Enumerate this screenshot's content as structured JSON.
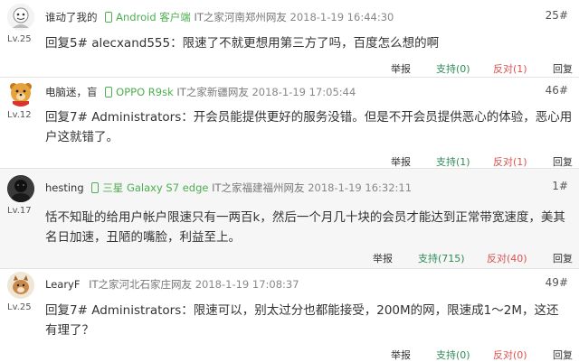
{
  "comments": [
    {
      "username": "谁动了我的",
      "device": "Android 客户端",
      "location": "IT之家河南郑州网友",
      "time": "2018-1-19 16:44:30",
      "floor": "25#",
      "level": "Lv.25",
      "content": "回复5# alecxand555：限速了不就更想用第三方了吗，百度怎么想的啊",
      "report": "举报",
      "support": "支持(0)",
      "oppose": "反对(1)",
      "reply": "回复"
    },
    {
      "username": "电脑迷，盲",
      "device": "OPPO R9sk",
      "location": "IT之家新疆网友",
      "time": "2018-1-19 17:05:44",
      "floor": "46#",
      "level": "Lv.12",
      "content": "回复7# Administrators：开会员能提供更好的服务没错。但是不开会员提供恶心的体验，恶心用户这就错了。",
      "report": "举报",
      "support": "支持(1)",
      "oppose": "反对(1)",
      "reply": "回复"
    },
    {
      "username": "hesting",
      "device": "三星 Galaxy S7 edge",
      "location": "IT之家福建福州网友",
      "time": "2018-1-19 16:32:11",
      "floor": "1#",
      "level": "Lv.17",
      "content": "恬不知耻的给用户帐户限速只有一两百k，然后一个月几十块的会员才能达到正常带宽速度，美其名日加速，丑陋的嘴脸，利益至上。",
      "report": "举报",
      "support": "支持(715)",
      "oppose": "反对(40)",
      "reply": "回复"
    },
    {
      "username": "LearyF",
      "device": "",
      "location": "IT之家河北石家庄网友",
      "time": "2018-1-19 17:08:37",
      "floor": "49#",
      "level": "Lv.25",
      "content": "回复7# Administrators：限速可以，别太过分也都能接受，200M的网，限速成1～2M，这还有理了？",
      "report": "举报",
      "support": "支持(0)",
      "oppose": "反对(0)",
      "reply": "回复"
    }
  ],
  "colors": {
    "device_green": "#4caf50",
    "support_green": "#2e8b57",
    "oppose_red": "#d9534f"
  }
}
